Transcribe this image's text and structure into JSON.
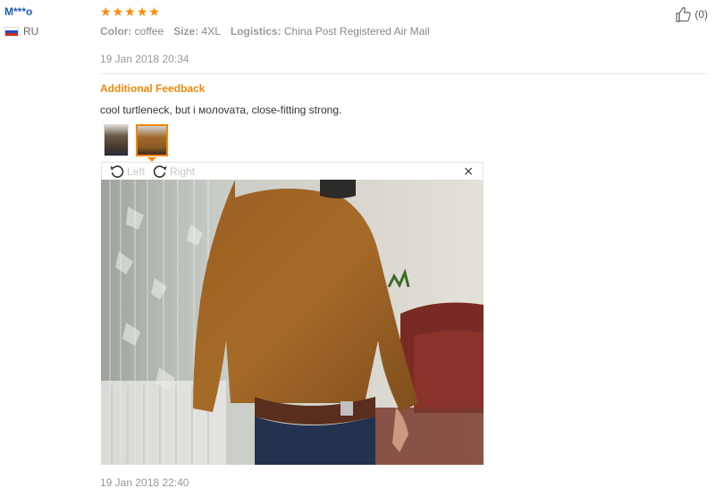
{
  "reviewer": {
    "name": "M***o",
    "country": "RU"
  },
  "review": {
    "rating_stars": 5,
    "attributes": [
      {
        "label": "Color:",
        "value": "coffee"
      },
      {
        "label": "Size:",
        "value": "4XL"
      },
      {
        "label": "Logistics:",
        "value": "China Post Registered Air Mail"
      }
    ],
    "date": "19 Jan 2018 20:34"
  },
  "helpful": {
    "count": "(0)",
    "icon": "thumbs-up-icon"
  },
  "additional_feedback": {
    "title": "Additional Feedback",
    "text": "cool turtleneck, but i молоvата, close-fitting strong.",
    "thumbnail_count": 2,
    "selected_thumbnail": 2,
    "viewer": {
      "rotate_left_label": "Left",
      "rotate_right_label": "Right",
      "close_symbol": "×"
    },
    "date": "19 Jan 2018 22:40"
  },
  "colors": {
    "accent_orange": "#f0890a",
    "star_orange": "#ff8a00",
    "name_blue": "#1a5fb4",
    "muted_gray": "#999999"
  }
}
